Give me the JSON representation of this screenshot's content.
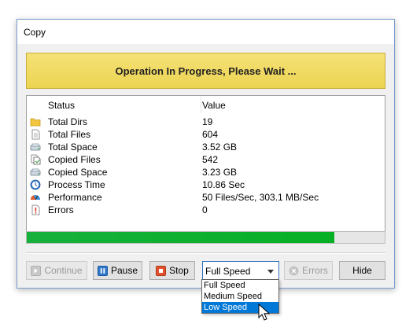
{
  "window": {
    "title": "Copy"
  },
  "banner": {
    "text": "Operation In Progress, Please Wait ..."
  },
  "list": {
    "headers": {
      "status": "Status",
      "value": "Value"
    },
    "rows": [
      {
        "label": "Total Dirs",
        "value": "19",
        "icon": "folder-icon"
      },
      {
        "label": "Total Files",
        "value": "604",
        "icon": "file-icon"
      },
      {
        "label": "Total Space",
        "value": "3.52 GB",
        "icon": "drive-icon"
      },
      {
        "label": "Copied Files",
        "value": "542",
        "icon": "copy-file-icon"
      },
      {
        "label": "Copied Space",
        "value": "3.23 GB",
        "icon": "drive-icon"
      },
      {
        "label": "Process Time",
        "value": "10.86 Sec",
        "icon": "clock-icon"
      },
      {
        "label": "Performance",
        "value": "50 Files/Sec, 303.1 MB/Sec",
        "icon": "performance-icon"
      },
      {
        "label": "Errors",
        "value": "0",
        "icon": "error-report-icon"
      }
    ]
  },
  "progress": {
    "percent": 86,
    "color": "#06b025"
  },
  "buttons": {
    "continue": "Continue",
    "pause": "Pause",
    "stop": "Stop",
    "errors": "Errors",
    "hide": "Hide"
  },
  "speed": {
    "selected": "Full Speed",
    "options": [
      "Full Speed",
      "Medium Speed",
      "Low Speed"
    ],
    "highlighted": "Low Speed"
  }
}
